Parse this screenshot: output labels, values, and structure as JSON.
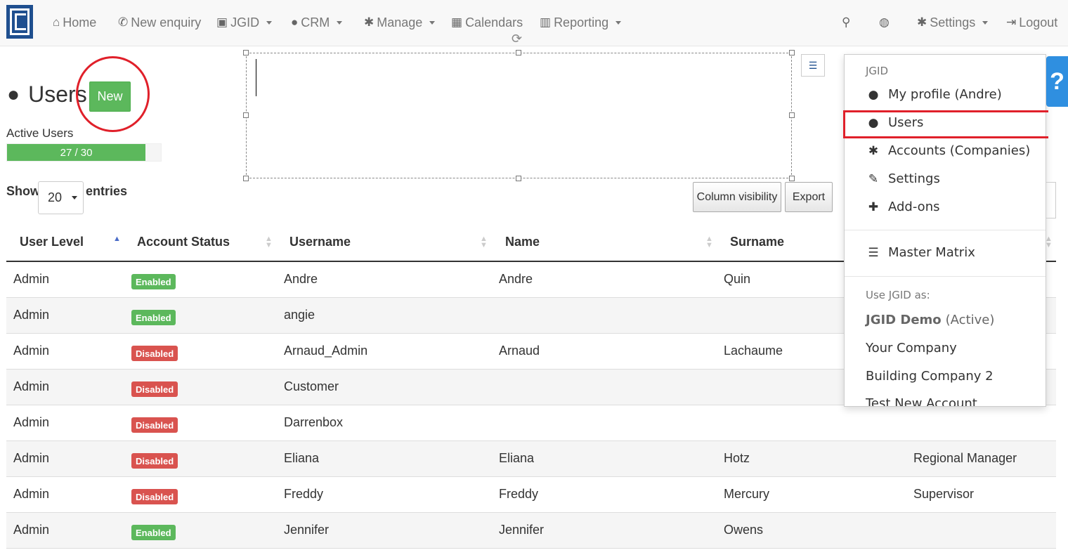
{
  "nav": {
    "home": "Home",
    "new_enquiry": "New enquiry",
    "jgid": "JGID",
    "crm": "CRM",
    "manage": "Manage",
    "calendars": "Calendars",
    "reporting": "Reporting",
    "settings": "Settings",
    "logout": "Logout"
  },
  "page": {
    "title": "Users",
    "new_button": "New",
    "active_users_label": "Active Users",
    "active_users_value": "27 / 30",
    "active_users_fraction": 0.9
  },
  "controls": {
    "show_label": "Show",
    "page_size": "20",
    "entries_label": "entries",
    "column_visibility": "Column visibility",
    "export": "Export"
  },
  "table": {
    "columns": [
      "User Level",
      "Account Status",
      "Username",
      "Name",
      "Surname"
    ],
    "rows": [
      {
        "level": "Admin",
        "status": "Enabled",
        "username": "Andre",
        "name": "Andre",
        "surname": "Quin",
        "role": ""
      },
      {
        "level": "Admin",
        "status": "Enabled",
        "username": "angie",
        "name": "",
        "surname": "",
        "role": ""
      },
      {
        "level": "Admin",
        "status": "Disabled",
        "username": "Arnaud_Admin",
        "name": "Arnaud",
        "surname": "Lachaume",
        "role": ""
      },
      {
        "level": "Admin",
        "status": "Disabled",
        "username": "Customer",
        "name": "",
        "surname": "",
        "role": ""
      },
      {
        "level": "Admin",
        "status": "Disabled",
        "username": "Darrenbox",
        "name": "",
        "surname": "",
        "role": ""
      },
      {
        "level": "Admin",
        "status": "Disabled",
        "username": "Eliana",
        "name": "Eliana",
        "surname": "Hotz",
        "role": "Regional Manager"
      },
      {
        "level": "Admin",
        "status": "Disabled",
        "username": "Freddy",
        "name": "Freddy",
        "surname": "Mercury",
        "role": "Supervisor"
      },
      {
        "level": "Admin",
        "status": "Enabled",
        "username": "Jennifer",
        "name": "Jennifer",
        "surname": "Owens",
        "role": ""
      }
    ]
  },
  "dropdown": {
    "header": "JGID",
    "my_profile": "My profile (Andre)",
    "users": "Users",
    "accounts": "Accounts (Companies)",
    "settings": "Settings",
    "addons": "Add-ons",
    "master_matrix": "Master Matrix",
    "use_as_header": "Use JGID as:",
    "active_company": "JGID Demo",
    "active_tag": "(Active)",
    "company_2": "Your Company",
    "company_3": "Building Company 2",
    "company_4": "Test New Account"
  },
  "help": "?",
  "colors": {
    "success": "#5cb85c",
    "danger": "#d9534f",
    "highlight": "#e0202a",
    "brand": "#1f4f8f"
  }
}
